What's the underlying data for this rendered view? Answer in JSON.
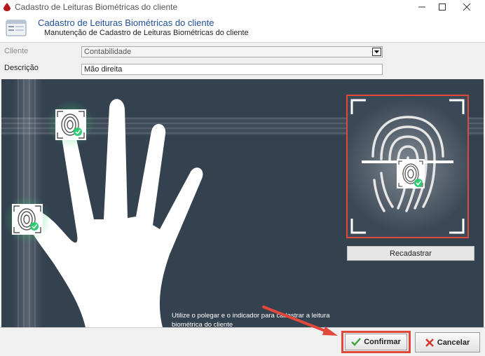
{
  "window": {
    "title": "Cadastro de Leituras Biométricas do cliente",
    "minimize_icon": "minimize-icon",
    "maximize_icon": "maximize-icon",
    "close_icon": "close-icon"
  },
  "header": {
    "title": "Cadastro de Leituras Biométricas do cliente",
    "subtitle": "Manutenção de Cadastro de Leituras Biométricas do cliente"
  },
  "form": {
    "cliente_label": "Cliente",
    "cliente_value": "Contabilidade",
    "descricao_label": "Descrição",
    "descricao_value": "Mão direita"
  },
  "biometric": {
    "instruction": "Utilize o polegar e o indicador para cadastrar a leitura biométrica do cliente",
    "recadastrar_label": "Recadastrar"
  },
  "actions": {
    "confirm_label": "Confirmar",
    "cancel_label": "Cancelar"
  },
  "colors": {
    "accent": "#1f4e99",
    "stage_bg": "#34414f",
    "highlight_red": "#e0483b",
    "check_green": "#2ecc71"
  }
}
